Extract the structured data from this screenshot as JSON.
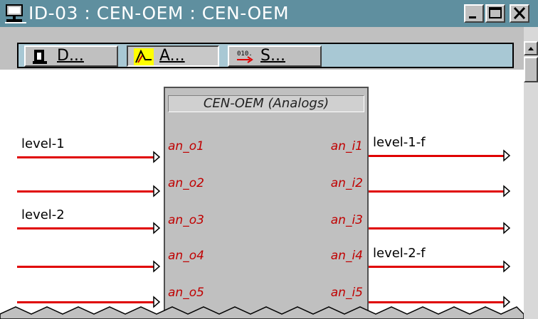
{
  "window": {
    "title": "ID-03 : CEN-OEM : CEN-OEM",
    "icon": "computer-icon",
    "controls": {
      "minimize": "minimize-icon",
      "maximize": "maximize-icon",
      "close": "close-icon"
    }
  },
  "toolbar": {
    "buttons": [
      {
        "label": "D...",
        "icon": "digital-icon",
        "active": false
      },
      {
        "label": "A...",
        "icon": "analog-icon",
        "active": true
      },
      {
        "label": "S...",
        "icon": "serial-icon",
        "active": false
      }
    ]
  },
  "block": {
    "title": "CEN-OEM (Analogs)",
    "left_pins": [
      "an_o1",
      "an_o2",
      "an_o3",
      "an_o4",
      "an_o5"
    ],
    "right_pins": [
      "an_i1",
      "an_i2",
      "an_i3",
      "an_i4",
      "an_i5"
    ]
  },
  "signals": {
    "left": [
      "level-1",
      "",
      "level-2",
      "",
      ""
    ],
    "right": [
      "level-1-f",
      "",
      "",
      "level-2-f",
      ""
    ]
  },
  "colors": {
    "titlebar": "#5f8f9f",
    "toolbar": "#a8c8d4",
    "wire": "#e00000",
    "pin_text": "#c00000"
  }
}
